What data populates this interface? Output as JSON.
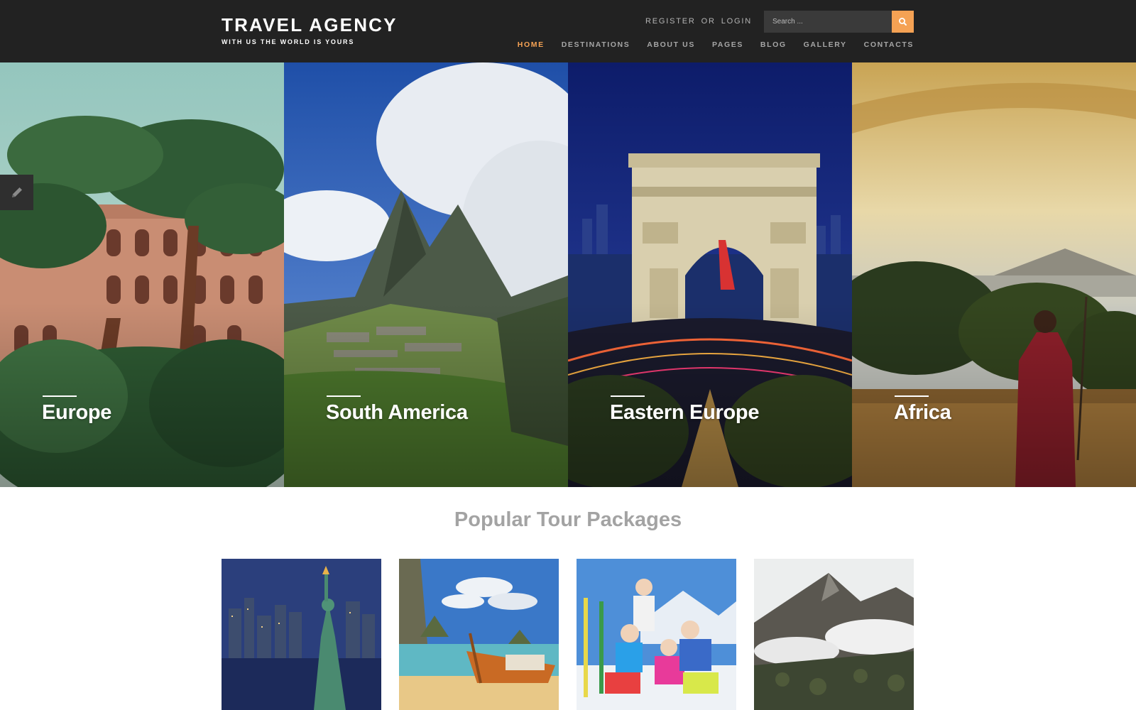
{
  "brand": {
    "title": "TRAVEL AGENCY",
    "tagline": "WITH US THE WORLD IS YOURS"
  },
  "auth": {
    "register": "REGISTER",
    "separator": "OR",
    "login": "LOGIN"
  },
  "search": {
    "placeholder": "Search ...",
    "button_icon": "search-icon"
  },
  "nav": {
    "items": [
      "HOME",
      "DESTINATIONS",
      "ABOUT US",
      "PAGES",
      "BLOG",
      "GALLERY",
      "CONTACTS"
    ],
    "active": "HOME"
  },
  "hero": {
    "destinations": [
      "Europe",
      "South America",
      "Eastern Europe",
      "Africa"
    ]
  },
  "edit_tab": {
    "icon": "pencil-icon"
  },
  "tours": {
    "title": "Popular Tour Packages"
  },
  "colors": {
    "header_bg": "#222222",
    "accent": "#f5a254",
    "nav_text": "#a6a6a6",
    "section_title": "#a3a3a3"
  }
}
